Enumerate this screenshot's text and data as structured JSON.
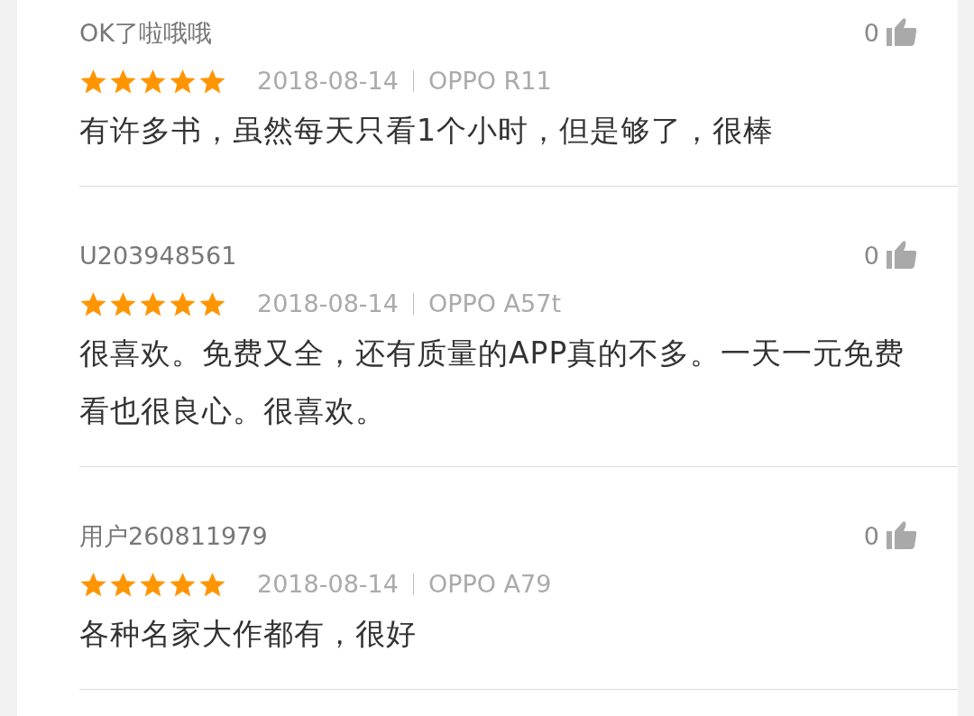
{
  "reviews": [
    {
      "user": "OK了啦哦哦",
      "likes": "0",
      "stars": 5,
      "date": "2018-08-14",
      "device": "OPPO R11",
      "text": "有许多书，虽然每天只看1个小时，但是够了，很棒"
    },
    {
      "user": "U203948561",
      "likes": "0",
      "stars": 5,
      "date": "2018-08-14",
      "device": "OPPO A57t",
      "text": "很喜欢。免费又全，还有质量的APP真的不多。一天一元免费看也很良心。很喜欢。"
    },
    {
      "user": "用户260811979",
      "likes": "0",
      "stars": 5,
      "date": "2018-08-14",
      "device": "OPPO A79",
      "text": "各种名家大作都有，很好"
    }
  ]
}
